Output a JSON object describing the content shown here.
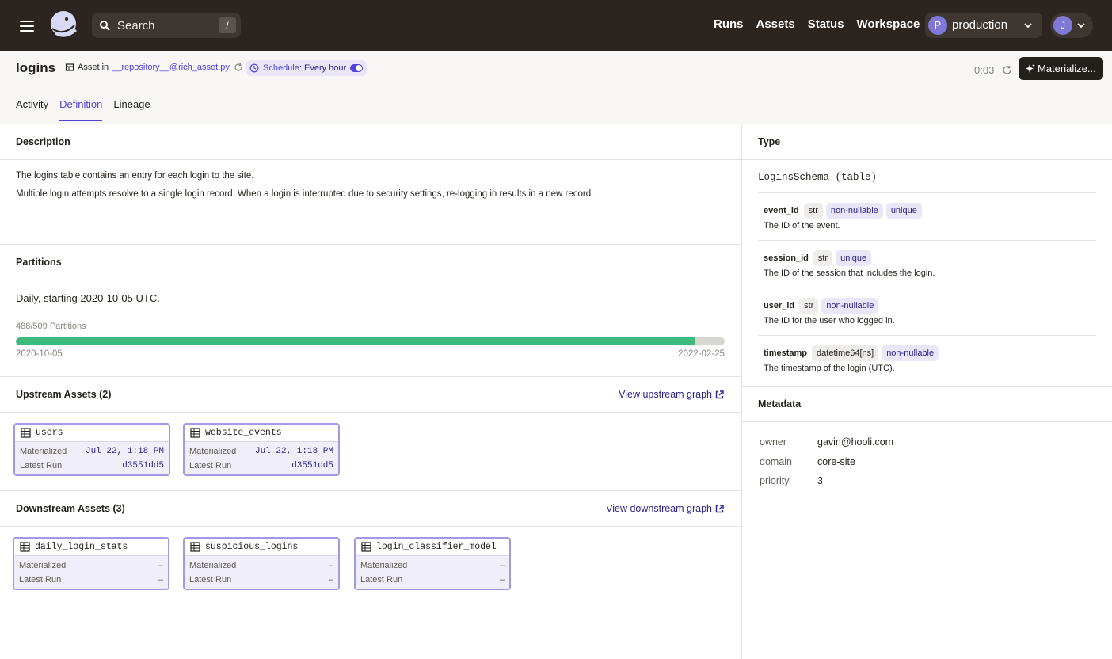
{
  "nav": {
    "search_placeholder": "Search",
    "search_shortcut": "/",
    "links": [
      "Runs",
      "Assets",
      "Status",
      "Workspace"
    ],
    "deployment": {
      "initial": "P",
      "label": "production"
    },
    "user_initial": "J"
  },
  "asset": {
    "title": "logins",
    "asset_in_label": "Asset in",
    "repository": "__repository__@rich_asset.py",
    "schedule_label": "Schedule:",
    "schedule_value": "Every hour",
    "refresh_time": "0:03",
    "materialize_label": "Materialize..."
  },
  "tabs": [
    {
      "label": "Activity",
      "active": false
    },
    {
      "label": "Definition",
      "active": true
    },
    {
      "label": "Lineage",
      "active": false
    }
  ],
  "description": {
    "heading": "Description",
    "lines": [
      "The logins table contains an entry for each login to the site.",
      "Multiple login attempts resolve to a single login record. When a login is interrupted due to security settings, re-logging in results in a new record."
    ]
  },
  "partitions": {
    "heading": "Partitions",
    "summary": "Daily, starting 2020-10-05 UTC.",
    "count_label": "488/509 Partitions",
    "materialized": 488,
    "total": 509,
    "start": "2020-10-05",
    "end": "2022-02-25"
  },
  "upstream": {
    "heading": "Upstream Assets (2)",
    "link": "View upstream graph",
    "materialized_label": "Materialized",
    "latest_run_label": "Latest Run",
    "cards": [
      {
        "name": "users",
        "materialized": "Jul 22, 1:18 PM",
        "latest_run": "d3551dd5"
      },
      {
        "name": "website_events",
        "materialized": "Jul 22, 1:18 PM",
        "latest_run": "d3551dd5"
      }
    ]
  },
  "downstream": {
    "heading": "Downstream Assets (3)",
    "link": "View downstream graph",
    "materialized_label": "Materialized",
    "latest_run_label": "Latest Run",
    "cards": [
      {
        "name": "daily_login_stats",
        "materialized": "–",
        "latest_run": "–"
      },
      {
        "name": "suspicious_logins",
        "materialized": "–",
        "latest_run": "–"
      },
      {
        "name": "login_classifier_model",
        "materialized": "–",
        "latest_run": "–"
      }
    ]
  },
  "type": {
    "heading": "Type",
    "name": "LoginsSchema (table)",
    "columns": [
      {
        "name": "event_id",
        "dtype": "str",
        "constraints": [
          "non-nullable",
          "unique"
        ],
        "description": "The ID of the event."
      },
      {
        "name": "session_id",
        "dtype": "str",
        "constraints": [
          "unique"
        ],
        "description": "The ID of the session that includes the login."
      },
      {
        "name": "user_id",
        "dtype": "str",
        "constraints": [
          "non-nullable"
        ],
        "description": "The ID for the user who logged in."
      },
      {
        "name": "timestamp",
        "dtype": "datetime64[ns]",
        "constraints": [
          "non-nullable"
        ],
        "description": "The timestamp of the login (UTC)."
      }
    ]
  },
  "metadata": {
    "heading": "Metadata",
    "entries": [
      {
        "key": "owner",
        "value": "gavin@hooli.com"
      },
      {
        "key": "domain",
        "value": "core-site"
      },
      {
        "key": "priority",
        "value": "3"
      }
    ]
  },
  "colors": {
    "accent": "#4f43dd",
    "topbar": "#2b241f",
    "progress": "#3dba7e"
  }
}
